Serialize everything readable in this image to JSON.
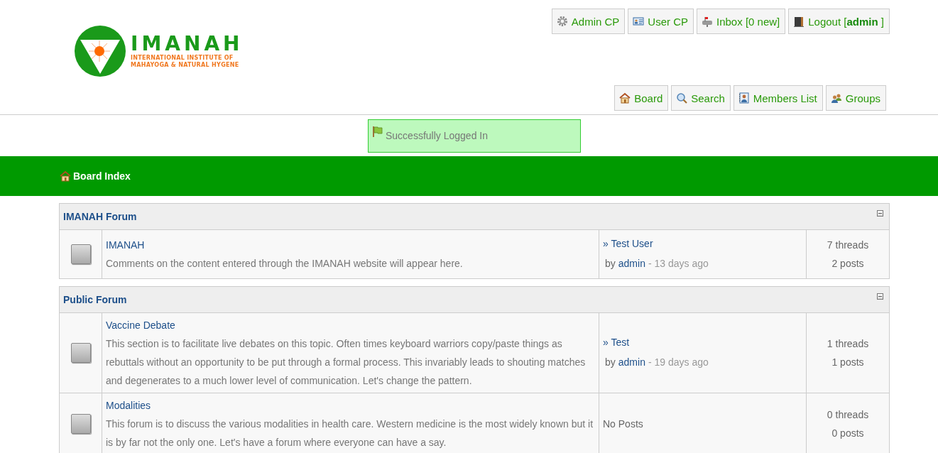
{
  "header": {
    "logo": {
      "name": "IMANAH",
      "tagline": [
        "INTERNATIONAL INSTITUTE OF",
        "MAHAYOGA & NATURAL HYGENE"
      ]
    },
    "user_links": [
      {
        "kind": "gear",
        "label": "Admin CP"
      },
      {
        "kind": "card",
        "label": "User CP"
      },
      {
        "kind": "mailbox",
        "label": "Inbox [0 new]"
      },
      {
        "kind": "door",
        "label": "Logout [**admin** ]"
      }
    ],
    "nav_links": [
      {
        "kind": "house",
        "label": "Board"
      },
      {
        "kind": "magnifier",
        "label": "Search"
      },
      {
        "kind": "book",
        "label": "Members List"
      },
      {
        "kind": "people",
        "label": "Groups"
      }
    ]
  },
  "message": {
    "text": "Successfully Logged In"
  },
  "breadcrumb": {
    "label": "Board Index"
  },
  "categories": [
    {
      "title": "IMANAH Forum",
      "forums": [
        {
          "title": "IMANAH",
          "description": "Comments on the content entered through the IMANAH website will appear here.",
          "last_post": {
            "thread": "» Test User",
            "by": "by",
            "author": "admin",
            "time": "- 13 days ago"
          },
          "threads": "7 threads",
          "posts": "2 posts"
        }
      ]
    },
    {
      "title": "Public Forum",
      "forums": [
        {
          "title": "Vaccine Debate",
          "description": "This section is to facilitate live debates on this topic. Often times keyboard warriors copy/paste things as rebuttals without an opportunity to be put through a formal process. This invariably leads to shouting matches and degenerates to a much lower level of communication. Let's change the pattern.",
          "last_post": {
            "thread": "» Test",
            "by": "by",
            "author": "admin",
            "time": "- 19 days ago"
          },
          "threads": "1 threads",
          "posts": "1 posts"
        },
        {
          "title": "Modalities",
          "description": "This forum is to discuss the various modalities in health care. Western medicine is the most widely known but it is by far not the only one. Let's have a forum where everyone can have a say.",
          "no_posts": "No Posts",
          "threads": "0 threads",
          "posts": "0 posts"
        }
      ]
    }
  ]
}
